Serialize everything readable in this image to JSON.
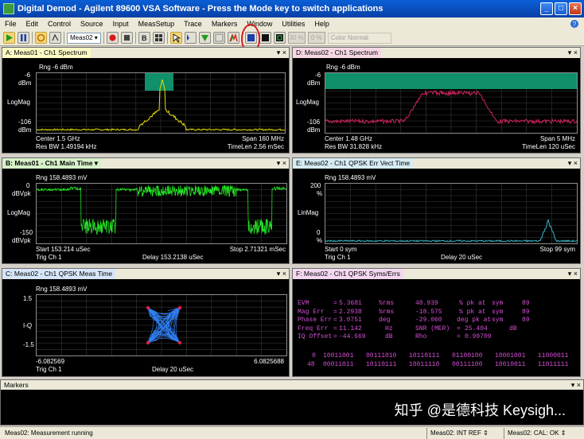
{
  "window": {
    "title": "Digital Demod - Agilent 89600 VSA Software - Press the Mode key to switch applications"
  },
  "menu": [
    "File",
    "Edit",
    "Control",
    "Source",
    "Input",
    "MeasSetup",
    "Trace",
    "Markers",
    "Window",
    "Utilities",
    "Help"
  ],
  "toolbar": {
    "meas_select": "Meas02",
    "pct1": "30 %",
    "pct2": "0 %",
    "color_mode": "Color Normal"
  },
  "panels": {
    "a": {
      "tab": "A: Meas01 - Ch1 Spectrum",
      "rng": "Rng -6 dBm",
      "y_top": "-6",
      "y_top_unit": "dBm",
      "y_scale": "LogMag",
      "y_bot": "-106",
      "y_bot_unit": "dBm",
      "bl1": "Center 1.5 GHz",
      "bl2": "Res BW 1.49194 kHz",
      "br1": "Span 160 MHz",
      "br2": "TimeLen 2.56 mSec"
    },
    "b": {
      "tab": "B: Meas01 - Ch1 Main Time",
      "rng": "Rng 158.4893 mV",
      "y_top": "0",
      "y_top_unit": "dBVpk",
      "y_scale": "LogMag",
      "y_bot": "-150",
      "y_bot_unit": "dBVpk",
      "bl1": "Start 153.214 uSec",
      "bl2": "Trig Ch 1",
      "bm2": "Delay 153.2138 uSec",
      "br1": "Stop 2.71321 mSec"
    },
    "c": {
      "tab": "C: Meas02 - Ch1 QPSK Meas Time",
      "rng": "Rng 158.4893 mV",
      "y_top": "1.5",
      "y_scale": "I-Q",
      "y_bot": "-1.5",
      "bl1": "-6.082569",
      "bl2": "Trig Ch 1",
      "bm2": "Delay 20 uSec",
      "br1": "6.0825688"
    },
    "d": {
      "tab": "D: Meas02 - Ch1 Spectrum",
      "rng": "Rng -6 dBm",
      "y_top": "-6",
      "y_top_unit": "dBm",
      "y_scale": "LogMag",
      "y_bot": "-106",
      "y_bot_unit": "dBm",
      "bl1": "Center 1.48 GHz",
      "bl2": "Res BW 31.828 kHz",
      "br1": "Span 5 MHz",
      "br2": "TimeLen 120 uSec"
    },
    "e": {
      "tab": "E: Meas02 - Ch1 QPSK Err Vect Time",
      "rng": "Rng 158.4893 mV",
      "y_top": "200",
      "y_top_unit": "%",
      "y_scale": "LinMag",
      "y_bot": "0",
      "y_bot_unit": "%",
      "bl1": "Start 0  sym",
      "bl2": "Trig Ch 1",
      "bm2": "Delay 20 uSec",
      "br1": "Stop 99  sym"
    },
    "f": {
      "tab": "F: Meas02 - Ch1 QPSK Syms/Errs",
      "errs": [
        [
          "EVM",
          "=",
          "5.3681",
          "%rms",
          "48.939",
          "% pk  at",
          "sym",
          "89"
        ],
        [
          "Mag Err",
          "=",
          "2.2938",
          "%rms",
          "-18.575",
          "% pk  at",
          "sym",
          "89"
        ],
        [
          "Phase Err",
          "=",
          "3.0751",
          "deg",
          "-29.060",
          "deg  pk  at",
          "sym",
          "89"
        ],
        [
          "Freq Err",
          "=",
          "11.142",
          "Hz",
          "SNR (MER)",
          "=",
          "25.404",
          "dB"
        ],
        [
          "IQ Offset",
          "=",
          "-44.669",
          "dB",
          "Rho",
          "=",
          "0.99709",
          ""
        ]
      ],
      "syms": [
        [
          "0",
          "10011001",
          "00111010",
          "10110111",
          "01100100",
          "10001001",
          "11000011"
        ],
        [
          "48",
          "00011011",
          "10110111",
          "10011110",
          "00111100",
          "10010011",
          "11011111"
        ]
      ]
    }
  },
  "markers": {
    "title": "Markers",
    "watermark": "知乎 @是德科技 Keysigh..."
  },
  "status": {
    "left": "Meas02:  Measurement running",
    "ref": "Meas02:  INT REF",
    "cal": "Meas02:   CAL: OK"
  },
  "colors": {
    "trace_a": "#e8e000",
    "trace_b": "#24e224",
    "trace_c": "#2f7df0",
    "trace_d": "#d0245e",
    "trace_e": "#3ab8c8",
    "sym_text": "#d64fd6",
    "band_fill": "#0f8f6a"
  }
}
